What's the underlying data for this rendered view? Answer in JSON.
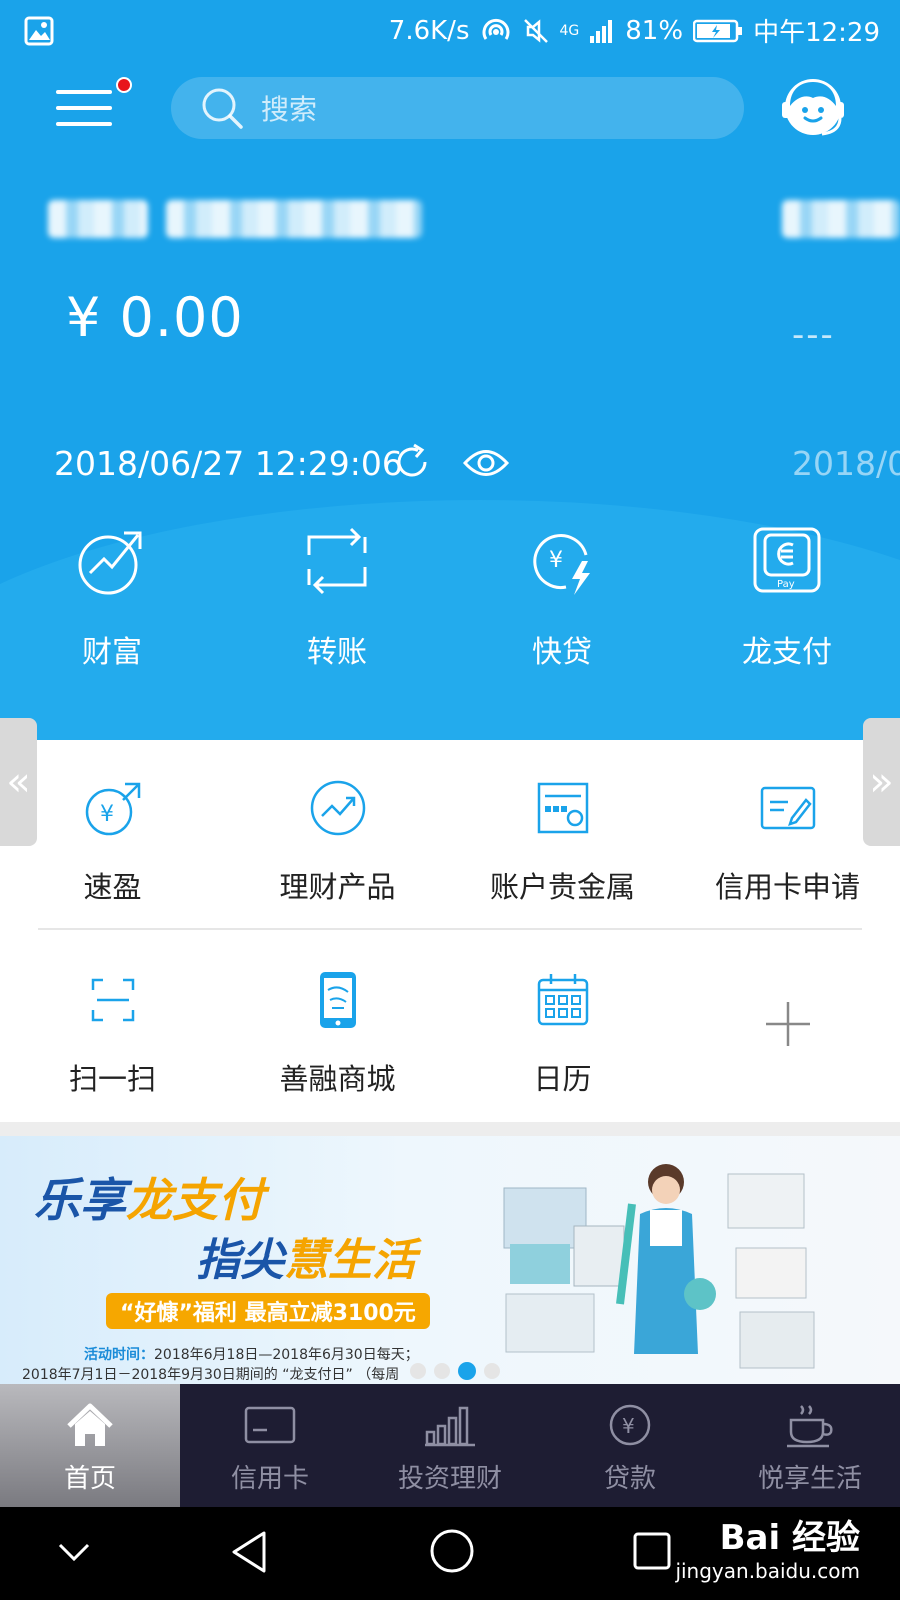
{
  "status_bar": {
    "speed": "7.6K/s",
    "network": "4G",
    "battery": "81%",
    "time": "中午12:29"
  },
  "header": {
    "search_placeholder": "搜索",
    "icons": [
      "menu-icon",
      "search-icon",
      "customer-service-icon"
    ]
  },
  "account": {
    "balance": "¥ 0.00",
    "balance_secondary": "---",
    "timestamp": "2018/06/27 12:29:06",
    "timestamp_secondary": "2018/0"
  },
  "quick_actions": [
    {
      "label": "财富",
      "icon": "wealth-icon"
    },
    {
      "label": "转账",
      "icon": "transfer-icon"
    },
    {
      "label": "快贷",
      "icon": "quick-loan-icon"
    },
    {
      "label": "龙支付",
      "icon": "long-pay-icon"
    }
  ],
  "grid_row1": [
    {
      "label": "速盈",
      "icon": "suying-icon"
    },
    {
      "label": "理财产品",
      "icon": "financial-products-icon"
    },
    {
      "label": "账户贵金属",
      "icon": "precious-metal-icon"
    },
    {
      "label": "信用卡申请",
      "icon": "credit-card-apply-icon"
    }
  ],
  "grid_row2": [
    {
      "label": "扫一扫",
      "icon": "scan-icon"
    },
    {
      "label": "善融商城",
      "icon": "mall-icon"
    },
    {
      "label": "日历",
      "icon": "calendar-icon"
    },
    {
      "label": "",
      "icon": "add-icon"
    }
  ],
  "banner": {
    "line1_a": "乐享",
    "line1_b": "龙支付",
    "line2_a": "指尖",
    "line2_b": "慧生活",
    "promo": "“好慷”福利 最高立减3100元",
    "activity_label": "活动时间：",
    "activity_1": "2018年6月18日—2018年6月30日每天；",
    "activity_2": "2018年7月1日－2018年9月30日期间的 “龙支付日” （每周",
    "page_count": 4,
    "active_page": 3
  },
  "tabs": [
    {
      "label": "首页",
      "icon": "home-icon",
      "active": true
    },
    {
      "label": "信用卡",
      "icon": "credit-card-icon",
      "active": false
    },
    {
      "label": "投资理财",
      "icon": "investment-icon",
      "active": false
    },
    {
      "label": "贷款",
      "icon": "loan-icon",
      "active": false
    },
    {
      "label": "悦享生活",
      "icon": "life-icon",
      "active": false
    }
  ],
  "watermark": {
    "brand": "Bai 经验",
    "url": "jingyan.baidu.com"
  },
  "colors": {
    "primary_blue": "#1aa3ea",
    "tab_bar": "#1e1d33",
    "badge_red": "#e8141b",
    "promo_orange": "#f6a700",
    "banner_blue": "#1a55a8"
  }
}
